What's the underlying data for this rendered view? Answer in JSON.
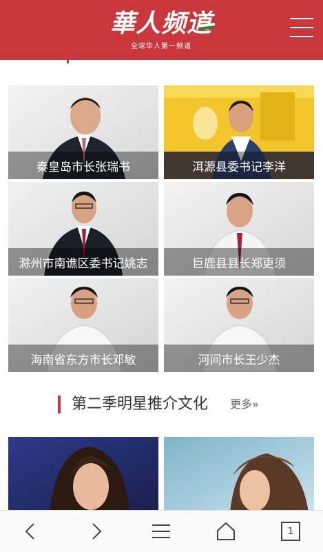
{
  "header": {
    "logo_text": "華人频道",
    "logo_subtitle": "全球华人第一频道",
    "menu_icon": "hamburger-menu-icon"
  },
  "officials": [
    {
      "caption": "秦皇岛市长张瑞书"
    },
    {
      "caption": "洱源县委书记李洋"
    },
    {
      "caption": "滁州市南谯区委书记姚志"
    },
    {
      "caption": "巨鹿县县长郑更须"
    },
    {
      "caption": "海南省东方市长邓敏"
    },
    {
      "caption": "河间市长王少杰"
    }
  ],
  "section": {
    "title": "第二季明星推介文化",
    "more": "更多»"
  },
  "bottom_nav": {
    "tab_count": "1",
    "icons": [
      "back-icon",
      "forward-icon",
      "menu-icon",
      "home-icon",
      "tabs-icon"
    ]
  },
  "colors": {
    "brand_red": "#c9363b",
    "caption_overlay": "rgba(0,0,0,0.38)"
  }
}
